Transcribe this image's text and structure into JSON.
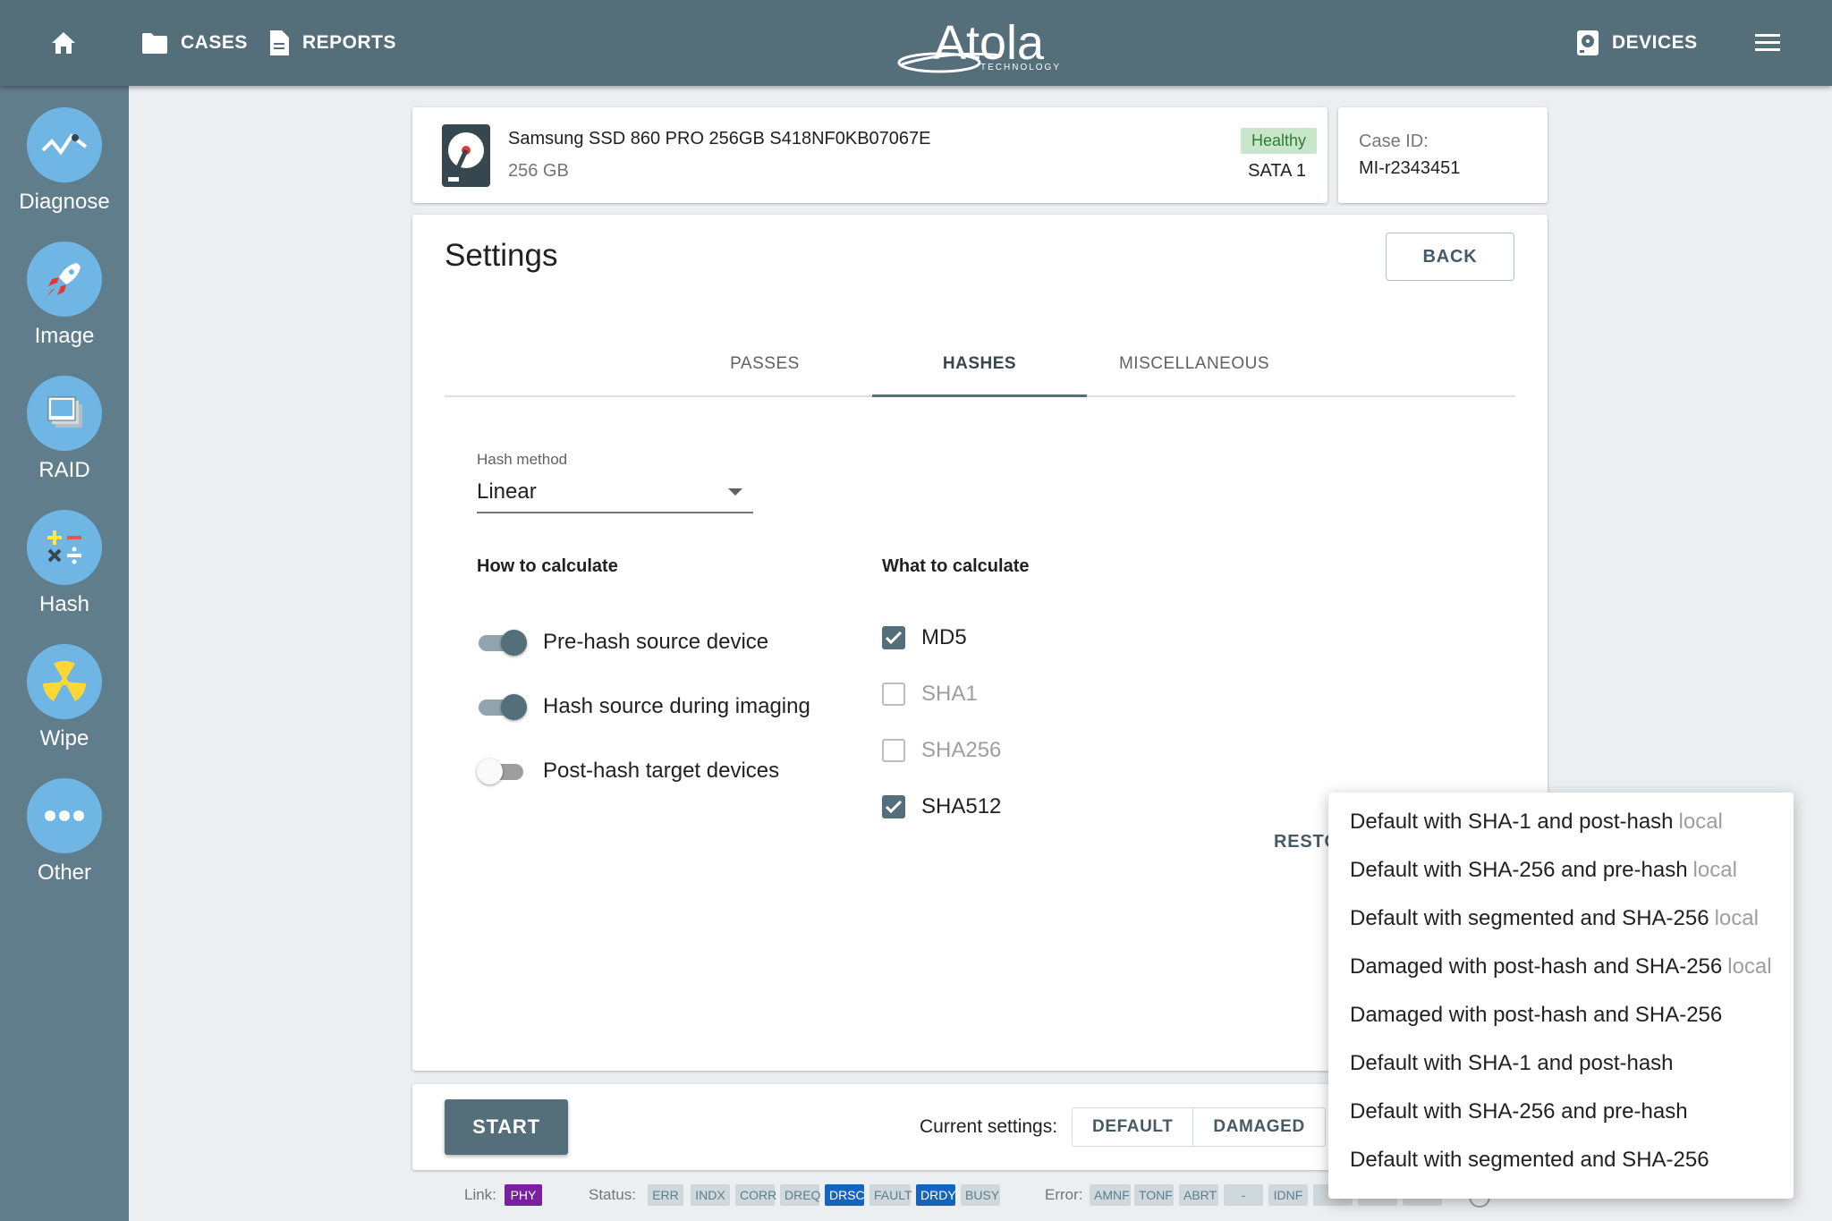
{
  "topbar": {
    "cases": "CASES",
    "reports": "REPORTS",
    "logo_text": "Atola",
    "logo_sub": "TECHNOLOGY",
    "devices": "DEVICES"
  },
  "sidebar": {
    "items": [
      {
        "label": "Diagnose",
        "icon": "diagnose-icon"
      },
      {
        "label": "Image",
        "icon": "rocket-icon"
      },
      {
        "label": "RAID",
        "icon": "raid-icon"
      },
      {
        "label": "Hash",
        "icon": "hash-icon"
      },
      {
        "label": "Wipe",
        "icon": "radiation-icon"
      },
      {
        "label": "Other",
        "icon": "dots-icon"
      }
    ]
  },
  "device": {
    "name": "Samsung SSD 860 PRO 256GB S418NF0KB07067E",
    "size": "256 GB",
    "health": "Healthy",
    "port": "SATA 1"
  },
  "case": {
    "label": "Case ID:",
    "value": "MI-r2343451"
  },
  "settings": {
    "title": "Settings",
    "back": "BACK",
    "tabs": [
      "PASSES",
      "HASHES",
      "MISCELLANEOUS"
    ],
    "active_tab": "HASHES",
    "hash_method_label": "Hash method",
    "hash_method_value": "Linear",
    "how_heading": "How to calculate",
    "what_heading": "What to calculate",
    "toggles": [
      {
        "label": "Pre-hash source device",
        "on": true
      },
      {
        "label": "Hash source during imaging",
        "on": true
      },
      {
        "label": "Post-hash target devices",
        "on": false
      }
    ],
    "checks": [
      {
        "label": "MD5",
        "checked": true
      },
      {
        "label": "SHA1",
        "checked": false
      },
      {
        "label": "SHA256",
        "checked": false
      },
      {
        "label": "SHA512",
        "checked": true
      }
    ],
    "restore": "RESTC"
  },
  "bottom": {
    "start": "START",
    "current_label": "Current settings:",
    "presets": [
      "DEFAULT",
      "DAMAGED"
    ]
  },
  "statusbar": {
    "link_label": "Link:",
    "link_chip": "PHY",
    "status_label": "Status:",
    "status_chips": [
      "ERR",
      "INDX",
      "CORR",
      "DREQ",
      "DRSC",
      "FAULT",
      "DRDY",
      "BUSY"
    ],
    "status_active": [
      "DRSC",
      "DRDY"
    ],
    "error_label": "Error:",
    "error_chips": [
      "AMNF",
      "TONF",
      "ABRT",
      "-",
      "IDNF"
    ]
  },
  "menu": {
    "items": [
      {
        "text": "Default with SHA-1 and post-hash",
        "tag": "local"
      },
      {
        "text": "Default with SHA-256 and pre-hash",
        "tag": "local"
      },
      {
        "text": "Default with segmented and SHA-256",
        "tag": "local"
      },
      {
        "text": "Damaged with post-hash and SHA-256",
        "tag": "local"
      },
      {
        "text": "Damaged with post-hash and SHA-256",
        "tag": ""
      },
      {
        "text": "Default with SHA-1 and post-hash",
        "tag": ""
      },
      {
        "text": "Default with SHA-256 and pre-hash",
        "tag": ""
      },
      {
        "text": "Default with segmented and SHA-256",
        "tag": ""
      }
    ]
  },
  "colors": {
    "topbar": "#546e7a",
    "sidebar": "#607d8b",
    "accent_circle": "#6fb6e4",
    "healthy_bg": "#c8e6c9",
    "chip_active": "#1565c0",
    "chip_phy": "#7b1fa2"
  }
}
